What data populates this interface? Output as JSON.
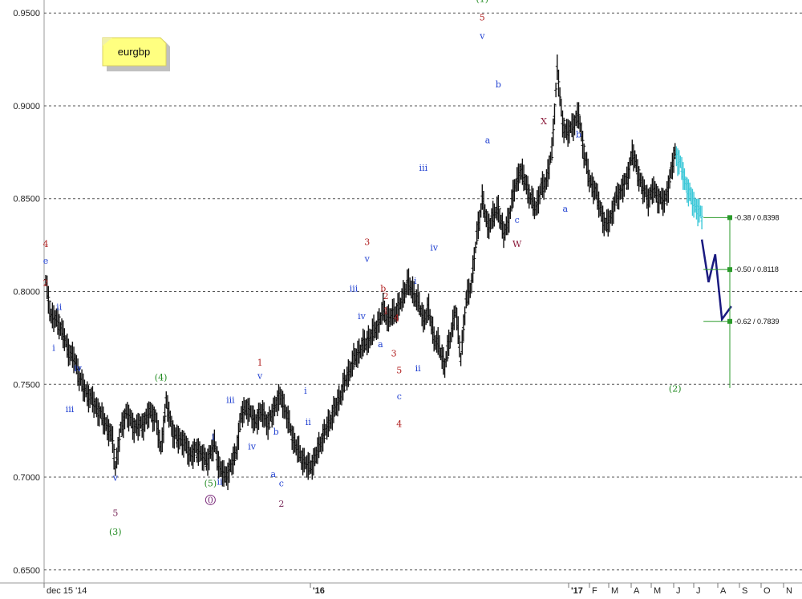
{
  "chart_data": {
    "type": "ohlc",
    "title": "",
    "symbol_note": "eurgbp",
    "y_axis": {
      "ticks": [
        "0.9500",
        "0.9000",
        "0.8500",
        "0.8000",
        "0.7500",
        "0.7000",
        "0.6500"
      ],
      "tick_values": [
        0.95,
        0.9,
        0.85,
        0.8,
        0.75,
        0.7,
        0.65
      ],
      "ylim": [
        0.643,
        0.957
      ],
      "grid": true
    },
    "x_axis": {
      "labels": [
        "dec 15 '14",
        "'16",
        "'17",
        "F",
        "M",
        "A",
        "M",
        "J",
        "J",
        "A",
        "S",
        "O",
        "N"
      ]
    },
    "price_path": [
      [
        0,
        0.805
      ],
      [
        4,
        0.787
      ],
      [
        10,
        0.783
      ],
      [
        16,
        0.77
      ],
      [
        22,
        0.762
      ],
      [
        28,
        0.748
      ],
      [
        34,
        0.742
      ],
      [
        40,
        0.735
      ],
      [
        46,
        0.727
      ],
      [
        50,
        0.72
      ],
      [
        52,
        0.705
      ],
      [
        56,
        0.725
      ],
      [
        60,
        0.735
      ],
      [
        66,
        0.727
      ],
      [
        72,
        0.728
      ],
      [
        78,
        0.735
      ],
      [
        82,
        0.732
      ],
      [
        86,
        0.715
      ],
      [
        90,
        0.74
      ],
      [
        96,
        0.722
      ],
      [
        102,
        0.72
      ],
      [
        108,
        0.712
      ],
      [
        114,
        0.715
      ],
      [
        120,
        0.708
      ],
      [
        126,
        0.718
      ],
      [
        130,
        0.705
      ],
      [
        134,
        0.7
      ],
      [
        138,
        0.705
      ],
      [
        142,
        0.713
      ],
      [
        146,
        0.733
      ],
      [
        150,
        0.738
      ],
      [
        156,
        0.73
      ],
      [
        162,
        0.735
      ],
      [
        166,
        0.728
      ],
      [
        172,
        0.74
      ],
      [
        176,
        0.743
      ],
      [
        182,
        0.728
      ],
      [
        186,
        0.718
      ],
      [
        190,
        0.712
      ],
      [
        196,
        0.705
      ],
      [
        200,
        0.708
      ],
      [
        206,
        0.72
      ],
      [
        212,
        0.73
      ],
      [
        218,
        0.74
      ],
      [
        224,
        0.752
      ],
      [
        230,
        0.763
      ],
      [
        236,
        0.77
      ],
      [
        242,
        0.775
      ],
      [
        248,
        0.782
      ],
      [
        252,
        0.79
      ],
      [
        256,
        0.785
      ],
      [
        262,
        0.79
      ],
      [
        266,
        0.795
      ],
      [
        270,
        0.805
      ],
      [
        274,
        0.8
      ],
      [
        278,
        0.795
      ],
      [
        282,
        0.785
      ],
      [
        286,
        0.79
      ],
      [
        290,
        0.775
      ],
      [
        294,
        0.77
      ],
      [
        298,
        0.76
      ],
      [
        302,
        0.775
      ],
      [
        306,
        0.79
      ],
      [
        310,
        0.765
      ],
      [
        314,
        0.795
      ],
      [
        318,
        0.805
      ],
      [
        322,
        0.83
      ],
      [
        326,
        0.85
      ],
      [
        330,
        0.835
      ],
      [
        334,
        0.84
      ],
      [
        338,
        0.845
      ],
      [
        342,
        0.83
      ],
      [
        346,
        0.84
      ],
      [
        350,
        0.855
      ],
      [
        354,
        0.865
      ],
      [
        358,
        0.86
      ],
      [
        362,
        0.85
      ],
      [
        366,
        0.845
      ],
      [
        370,
        0.855
      ],
      [
        374,
        0.86
      ],
      [
        378,
        0.875
      ],
      [
        382,
        0.92
      ],
      [
        386,
        0.89
      ],
      [
        390,
        0.885
      ],
      [
        394,
        0.89
      ],
      [
        398,
        0.895
      ],
      [
        402,
        0.875
      ],
      [
        406,
        0.86
      ],
      [
        410,
        0.855
      ],
      [
        414,
        0.845
      ],
      [
        418,
        0.835
      ],
      [
        422,
        0.84
      ],
      [
        426,
        0.85
      ],
      [
        430,
        0.855
      ],
      [
        434,
        0.86
      ],
      [
        438,
        0.875
      ],
      [
        442,
        0.865
      ],
      [
        446,
        0.855
      ],
      [
        450,
        0.85
      ],
      [
        454,
        0.855
      ],
      [
        458,
        0.85
      ],
      [
        462,
        0.848
      ],
      [
        466,
        0.86
      ],
      [
        470,
        0.875
      ],
      [
        474,
        0.868
      ],
      [
        478,
        0.858
      ],
      [
        482,
        0.85
      ],
      [
        486,
        0.845
      ],
      [
        490,
        0.84
      ]
    ],
    "projection": {
      "color": "#1a1a80",
      "points": [
        [
          490,
          0.828
        ],
        [
          495,
          0.805
        ],
        [
          500,
          0.82
        ],
        [
          505,
          0.785
        ],
        [
          512,
          0.792
        ]
      ]
    },
    "fib_levels": [
      {
        "label": "0.38 / 0.8398",
        "value": 0.8398
      },
      {
        "label": "0.50 / 0.8118",
        "value": 0.8118
      },
      {
        "label": "0.62 / 0.7839",
        "value": 0.7839
      }
    ],
    "wave_labels": [
      {
        "text": "4",
        "color": "#b22222",
        "x": 0,
        "y": 0.824
      },
      {
        "text": "e",
        "color": "#1f3fd1",
        "x": 0,
        "y": 0.815
      },
      {
        "text": "2",
        "color": "#b22222",
        "x": 0,
        "y": 0.803
      },
      {
        "text": "ii",
        "color": "#1f3fd1",
        "x": 10,
        "y": 0.79
      },
      {
        "text": "i",
        "color": "#1f3fd1",
        "x": 6,
        "y": 0.768
      },
      {
        "text": "iv",
        "color": "#1f3fd1",
        "x": 24,
        "y": 0.757
      },
      {
        "text": "iii",
        "color": "#1f3fd1",
        "x": 18,
        "y": 0.735
      },
      {
        "text": "v",
        "color": "#1f3fd1",
        "x": 52,
        "y": 0.698
      },
      {
        "text": "5",
        "color": "#7a2a5a",
        "x": 52,
        "y": 0.679
      },
      {
        "text": "(3)",
        "color": "#228b22",
        "x": 52,
        "y": 0.669
      },
      {
        "text": "(4)",
        "color": "#228b22",
        "x": 86,
        "y": 0.752
      },
      {
        "text": "i",
        "color": "#1f3fd1",
        "x": 125,
        "y": 0.72
      },
      {
        "text": "ii",
        "color": "#1f3fd1",
        "x": 130,
        "y": 0.696
      },
      {
        "text": "(5)",
        "color": "#228b22",
        "x": 123,
        "y": 0.695
      },
      {
        "text": "0",
        "color": "#7a2a7a",
        "x": 123,
        "y": 0.686
      },
      {
        "text": "iii",
        "color": "#1f3fd1",
        "x": 138,
        "y": 0.74
      },
      {
        "text": "iv",
        "color": "#1f3fd1",
        "x": 154,
        "y": 0.715
      },
      {
        "text": "1",
        "color": "#b22222",
        "x": 160,
        "y": 0.76
      },
      {
        "text": "v",
        "color": "#1f3fd1",
        "x": 160,
        "y": 0.753
      },
      {
        "text": "b",
        "color": "#1f3fd1",
        "x": 172,
        "y": 0.723
      },
      {
        "text": "a",
        "color": "#1f3fd1",
        "x": 170,
        "y": 0.7
      },
      {
        "text": "c",
        "color": "#1f3fd1",
        "x": 176,
        "y": 0.695
      },
      {
        "text": "2",
        "color": "#7a2a5a",
        "x": 176,
        "y": 0.684
      },
      {
        "text": "i",
        "color": "#1f3fd1",
        "x": 194,
        "y": 0.745
      },
      {
        "text": "ii",
        "color": "#1f3fd1",
        "x": 196,
        "y": 0.728
      },
      {
        "text": "3",
        "color": "#b22222",
        "x": 240,
        "y": 0.825
      },
      {
        "text": "v",
        "color": "#1f3fd1",
        "x": 240,
        "y": 0.816
      },
      {
        "text": "iii",
        "color": "#1f3fd1",
        "x": 230,
        "y": 0.8
      },
      {
        "text": "iv",
        "color": "#1f3fd1",
        "x": 236,
        "y": 0.785
      },
      {
        "text": "a",
        "color": "#1f3fd1",
        "x": 250,
        "y": 0.77
      },
      {
        "text": "b",
        "color": "#b22222",
        "x": 252,
        "y": 0.8
      },
      {
        "text": "2",
        "color": "#b22222",
        "x": 254,
        "y": 0.796
      },
      {
        "text": "1",
        "color": "#b22222",
        "x": 254,
        "y": 0.788
      },
      {
        "text": "4",
        "color": "#b22222",
        "x": 262,
        "y": 0.784
      },
      {
        "text": "3",
        "color": "#b22222",
        "x": 260,
        "y": 0.765
      },
      {
        "text": "5",
        "color": "#b22222",
        "x": 264,
        "y": 0.756
      },
      {
        "text": "c",
        "color": "#1f3fd1",
        "x": 264,
        "y": 0.742
      },
      {
        "text": "4",
        "color": "#b22222",
        "x": 264,
        "y": 0.727
      },
      {
        "text": "i",
        "color": "#1f3fd1",
        "x": 276,
        "y": 0.804
      },
      {
        "text": "ii",
        "color": "#1f3fd1",
        "x": 278,
        "y": 0.757
      },
      {
        "text": "iii",
        "color": "#1f3fd1",
        "x": 282,
        "y": 0.865
      },
      {
        "text": "iv",
        "color": "#1f3fd1",
        "x": 290,
        "y": 0.822
      },
      {
        "text": "(1)",
        "color": "#228b22",
        "x": 326,
        "y": 0.956
      },
      {
        "text": "5",
        "color": "#b22222",
        "x": 326,
        "y": 0.946
      },
      {
        "text": "v",
        "color": "#1f3fd1",
        "x": 326,
        "y": 0.936
      },
      {
        "text": "b",
        "color": "#1f3fd1",
        "x": 338,
        "y": 0.91
      },
      {
        "text": "a",
        "color": "#1f3fd1",
        "x": 330,
        "y": 0.88
      },
      {
        "text": "c",
        "color": "#1f3fd1",
        "x": 352,
        "y": 0.837
      },
      {
        "text": "W",
        "color": "#8b1a3a",
        "x": 352,
        "y": 0.824
      },
      {
        "text": "X",
        "color": "#8b1a3a",
        "x": 372,
        "y": 0.89
      },
      {
        "text": "b",
        "color": "#1f3fd1",
        "x": 398,
        "y": 0.883
      },
      {
        "text": "a",
        "color": "#1f3fd1",
        "x": 388,
        "y": 0.843
      },
      {
        "text": "(2)",
        "color": "#228b22",
        "x": 470,
        "y": 0.746
      }
    ]
  }
}
